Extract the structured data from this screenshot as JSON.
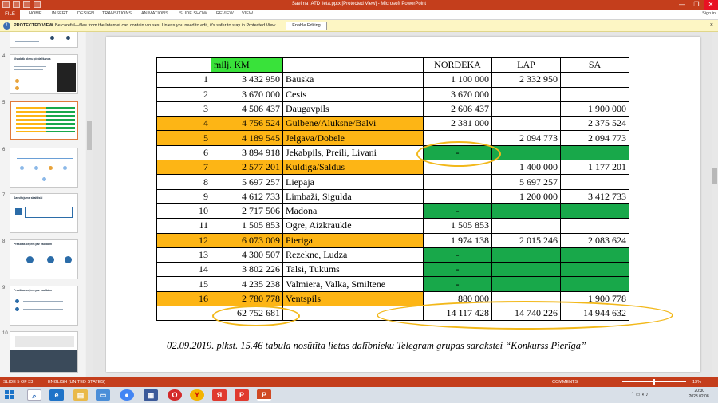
{
  "window": {
    "title": "Saeima_ATD lieta.pptx [Protected View] - Microsoft PowerPoint",
    "minimize": "—",
    "maximize": "❐",
    "close": "✕"
  },
  "ribbon": {
    "file": "FILE",
    "tabs": [
      "HOME",
      "INSERT",
      "DESIGN",
      "TRANSITIONS",
      "ANIMATIONS",
      "SLIDE SHOW",
      "REVIEW",
      "VIEW"
    ],
    "signin": "Sign in"
  },
  "protected_view": {
    "title": "PROTECTED VIEW",
    "message": "Be careful—files from the Internet can contain viruses. Unless you need to edit, it's safer to stay in Protected View.",
    "enable_button": "Enable Editing",
    "close": "×"
  },
  "thumbnails": {
    "items": [
      {
        "number": "4",
        "title": "Vislabāk plenu piedalīšanos"
      },
      {
        "number": "5",
        "title": ""
      },
      {
        "number": "6",
        "title": ""
      },
      {
        "number": "7",
        "title": "Sasvītojums skaitliski"
      },
      {
        "number": "8",
        "title": "Prasības ceļiem par vadībām"
      },
      {
        "number": "9",
        "title": "Prasības ceļiem par vadībām"
      },
      {
        "number": "10",
        "title": ""
      }
    ],
    "selected": "5"
  },
  "slide": {
    "header": {
      "col_amount": "milj. KM",
      "col_nordeka": "NORDEKA",
      "col_lap": "LAP",
      "col_sa": "SA"
    },
    "rows": [
      {
        "n": "1",
        "amount": "3 432 950",
        "name": "Bauska",
        "nordeka": "1 100 000",
        "lap": "2 332 950",
        "sa": "",
        "row": "",
        "nord": "",
        "lapc": "",
        "sac": ""
      },
      {
        "n": "2",
        "amount": "3 670 000",
        "name": "Cesis",
        "nordeka": "3 670 000",
        "lap": "",
        "sa": "",
        "row": "",
        "nord": "",
        "lapc": "",
        "sac": ""
      },
      {
        "n": "3",
        "amount": "4 506 437",
        "name": "Daugavpils",
        "nordeka": "2 606 437",
        "lap": "",
        "sa": "1 900 000",
        "row": "",
        "nord": "",
        "lapc": "",
        "sac": ""
      },
      {
        "n": "4",
        "amount": "4 756 524",
        "name": "Gulbene/Aluksne/Balvi",
        "nordeka": "2 381 000",
        "lap": "",
        "sa": "2 375 524",
        "row": "orange",
        "nord": "",
        "lapc": "",
        "sac": ""
      },
      {
        "n": "5",
        "amount": "4 189 545",
        "name": "Jelgava/Dobele",
        "nordeka": "",
        "lap": "2 094 773",
        "sa": "2 094 773",
        "row": "orange",
        "nord": "",
        "lapc": "",
        "sac": ""
      },
      {
        "n": "6",
        "amount": "3 894 918",
        "name": "Jekabpils, Preili, Livani",
        "nordeka": "-",
        "lap": "",
        "sa": "",
        "row": "",
        "nord": "green",
        "lapc": "green",
        "sac": "green"
      },
      {
        "n": "7",
        "amount": "2 577 201",
        "name": "Kuldiga/Saldus",
        "nordeka": "",
        "lap": "1 400 000",
        "sa": "1 177 201",
        "row": "orange",
        "nord": "",
        "lapc": "",
        "sac": ""
      },
      {
        "n": "8",
        "amount": "5 697 257",
        "name": "Liepaja",
        "nordeka": "",
        "lap": "5 697 257",
        "sa": "",
        "row": "",
        "nord": "",
        "lapc": "",
        "sac": ""
      },
      {
        "n": "9",
        "amount": "4 612 733",
        "name": "Limbaži, Sigulda",
        "nordeka": "",
        "lap": "1 200 000",
        "sa": "3 412 733",
        "row": "",
        "nord": "",
        "lapc": "",
        "sac": ""
      },
      {
        "n": "10",
        "amount": "2 717 506",
        "name": "Madona",
        "nordeka": "-",
        "lap": "",
        "sa": "",
        "row": "",
        "nord": "green",
        "lapc": "green",
        "sac": "green"
      },
      {
        "n": "11",
        "amount": "1 505 853",
        "name": "Ogre, Aizkraukle",
        "nordeka": "1 505 853",
        "lap": "",
        "sa": "",
        "row": "",
        "nord": "",
        "lapc": "",
        "sac": ""
      },
      {
        "n": "12",
        "amount": "6 073 009",
        "name": "Pieriga",
        "nordeka": "1 974 138",
        "lap": "2 015 246",
        "sa": "2 083 624",
        "row": "orange",
        "nord": "",
        "lapc": "",
        "sac": ""
      },
      {
        "n": "13",
        "amount": "4 300 507",
        "name": "Rezekne, Ludza",
        "nordeka": "-",
        "lap": "",
        "sa": "",
        "row": "",
        "nord": "green",
        "lapc": "green",
        "sac": "green"
      },
      {
        "n": "14",
        "amount": "3 802 226",
        "name": "Talsi, Tukums",
        "nordeka": "-",
        "lap": "",
        "sa": "",
        "row": "",
        "nord": "green",
        "lapc": "green",
        "sac": "green"
      },
      {
        "n": "15",
        "amount": "4 235 238",
        "name": "Valmiera, Valka, Smiltene",
        "nordeka": "-",
        "lap": "",
        "sa": "",
        "row": "",
        "nord": "green",
        "lapc": "green",
        "sac": "green"
      },
      {
        "n": "16",
        "amount": "2 780 778",
        "name": "Ventspils",
        "nordeka": "880 000",
        "lap": "",
        "sa": "1 900 778",
        "row": "orange",
        "nord": "",
        "lapc": "",
        "sac": ""
      }
    ],
    "totals": {
      "amount": "62 752 681",
      "nordeka": "14 117 428",
      "lap": "14 740 226",
      "sa": "14 944 632"
    },
    "caption_prefix": "02.09.2019. plkst. 15.46 tabula nosūtīta lietas dalībnieku ",
    "caption_link": "Telegram",
    "caption_suffix": " grupas sarakstei “Konkurss Pierīga”"
  },
  "statusbar": {
    "slide_info": "SLIDE 5 OF 33",
    "language": "ENGLISH (UNITED STATES)",
    "comments": "COMMENTS",
    "zoom": "13%"
  },
  "taskbar": {
    "time": "20:30",
    "date": "2023.02.08."
  },
  "colors": {
    "accent": "#c43e1c",
    "orange": "#fdb515",
    "green": "#18a84a",
    "highlight": "#39e23a",
    "ellipse": "#f2b81a"
  }
}
